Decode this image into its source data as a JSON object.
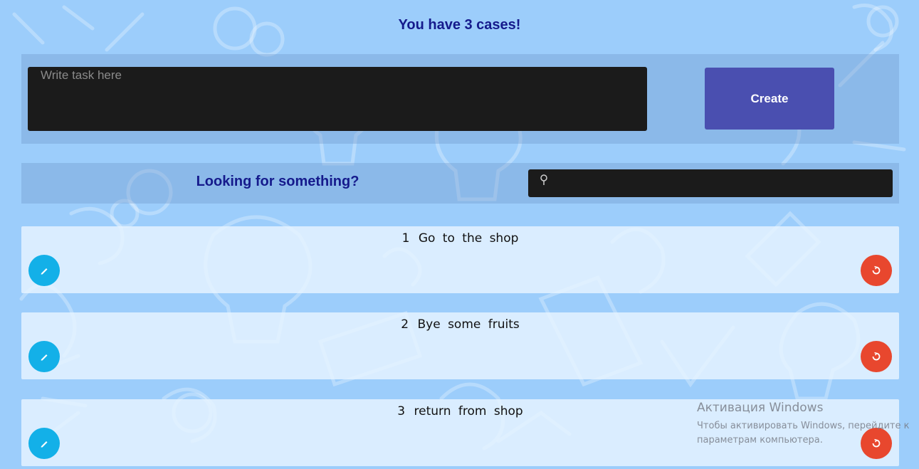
{
  "header": {
    "title": "You have 3 cases!"
  },
  "create_form": {
    "placeholder": "Write task here",
    "value": "",
    "button_label": "Create"
  },
  "search": {
    "label": "Looking for something?",
    "icon": "search-icon",
    "value": ""
  },
  "tasks": [
    {
      "number": "1",
      "text": "Go to the shop"
    },
    {
      "number": "2",
      "text": "Bye some fruits"
    },
    {
      "number": "3",
      "text": "return from shop"
    }
  ],
  "task_actions": {
    "edit_icon": "pencil-icon",
    "delete_icon": "recycle-icon"
  },
  "windows_watermark": {
    "title": "Активация Windows",
    "line1": "Чтобы активировать Windows, перейдите к",
    "line2": "параметрам компьютера."
  },
  "colors": {
    "background": "#9ccdfb",
    "heading": "#151a8c",
    "create_button": "#4a4fb0",
    "edit_button": "#13b0e8",
    "delete_button": "#e8472e",
    "input_background": "#1b1b1b"
  }
}
